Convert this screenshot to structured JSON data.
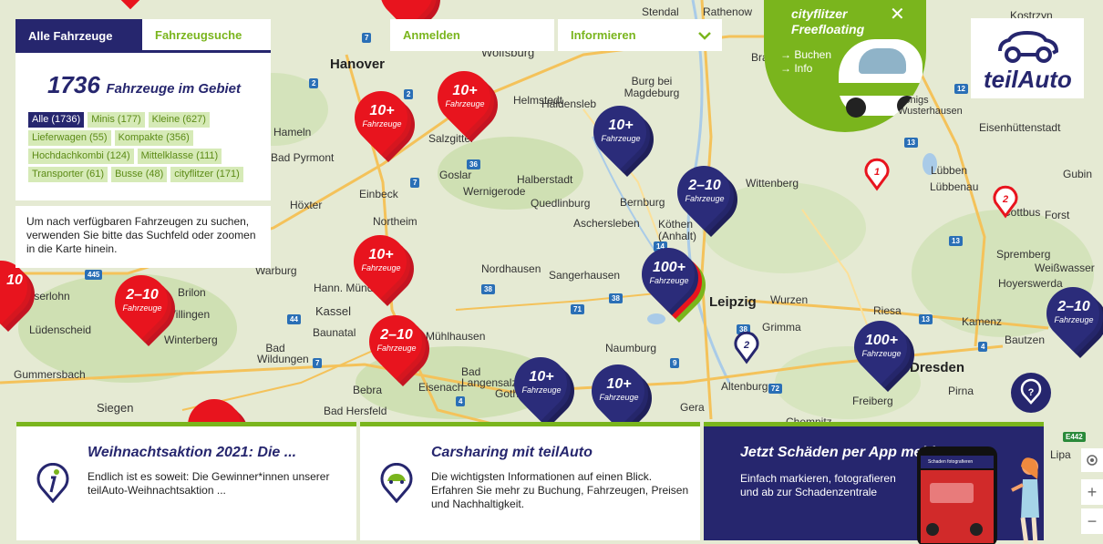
{
  "tabs": {
    "all": "Alle Fahrzeuge",
    "search": "Fahrzeugsuche"
  },
  "fleet": {
    "count": "1736",
    "count_label": "Fahrzeuge im Gebiet",
    "chips": [
      {
        "label": "Alle (1736)",
        "active": true
      },
      {
        "label": "Minis (177)",
        "active": false
      },
      {
        "label": "Kleine (627)",
        "active": false
      },
      {
        "label": "Lieferwagen (55)",
        "active": false
      },
      {
        "label": "Kompakte (356)",
        "active": false
      },
      {
        "label": "Hochdachkombi (124)",
        "active": false
      },
      {
        "label": "Mittelklasse (111)",
        "active": false
      },
      {
        "label": "Transporter (61)",
        "active": false
      },
      {
        "label": "Busse (48)",
        "active": false
      },
      {
        "label": "cityflitzer (171)",
        "active": false
      }
    ]
  },
  "hint": "Um nach verfügbaren Fahrzeugen zu suchen, verwenden Sie bitte das Suchfeld oder zoomen in die Karte hinein.",
  "header": {
    "login": "Anmelden",
    "info": "Informieren"
  },
  "cityflitzer": {
    "title_line1": "cityflitzer",
    "title_line2": "Freefloating",
    "link_book": "→ Buchen",
    "link_info": "→ Info",
    "car_brand": "cityflitzer"
  },
  "logo": {
    "text": "teilAuto"
  },
  "cards": [
    {
      "title": "Weihnachtsaktion 2021: Die ...",
      "body": "Endlich ist es soweit: Die Gewinner*innen unserer teilAuto-Weihnachtsaktion ..."
    },
    {
      "title": "Carsharing mit teilAuto",
      "body": "Die wichtigsten Informationen auf einen Blick. Erfahren Sie mehr zu Buchung, Fahrzeugen, Preisen und Nachhaltigkeit."
    },
    {
      "title": "Jetzt Schäden per App melden",
      "body": "Einfach markieren, fotografieren und ab zur Schadenzentrale",
      "phone_header": "Schaden fotografieren"
    }
  ],
  "pin_sub": "Fahrzeuge",
  "pins": [
    {
      "label": "10+",
      "color": "red"
    },
    {
      "label": "10+",
      "color": "red"
    },
    {
      "label": "10+",
      "color": "blue"
    },
    {
      "label": "2–10",
      "color": "blue"
    },
    {
      "label": "10+",
      "color": "red"
    },
    {
      "label": "100+",
      "color": "blue"
    },
    {
      "label": "2–10",
      "color": "red"
    },
    {
      "label": "2–10",
      "color": "red"
    },
    {
      "label": "10+",
      "color": "blue"
    },
    {
      "label": "10+",
      "color": "blue"
    },
    {
      "label": "100+",
      "color": "blue"
    },
    {
      "label": "2–10",
      "color": "blue"
    },
    {
      "label": "10",
      "color": "red"
    }
  ],
  "mini_pins": [
    "1",
    "2",
    "2"
  ],
  "cities": [
    "Stendal",
    "Rathenow",
    "Kostrzyn",
    "Wolfsburg",
    "Hanover",
    "Brandenb",
    "Burg bei Magdeburg",
    "Helmstedt",
    "Haldensleb",
    "Königs Wusterhausen",
    "Eisenhüttenstadt",
    "Hameln",
    "Salzgitter",
    "Bad Pyrmont",
    "Goslar",
    "Halberstadt",
    "Wernigerode",
    "Quedlinburg",
    "Bernburg",
    "Wittenberg",
    "Lübben",
    "Lübbenau",
    "Gubin",
    "Einbeck",
    "Höxter",
    "Aschersleben",
    "Köthen (Anhalt)",
    "Cottbus",
    "Forst",
    "Northeim",
    "Spremberg",
    "Weißwasser",
    "Nordhausen",
    "Sangerhausen",
    "Hoyerswerda",
    "Warburg",
    "Hann. Münden",
    "Brilon",
    "Leipzig",
    "Wurzen",
    "Iserlohn",
    "Kassel",
    "Riesa",
    "Kamenz",
    "Villingen",
    "Lüdenscheid",
    "Baunatal",
    "Mühlhausen",
    "Grimma",
    "Bautzen",
    "Winterberg",
    "Bad Wildungen",
    "Naumburg",
    "Gummersbach",
    "Bad Langensalza",
    "Gotha",
    "Eisenach",
    "Bebra",
    "Altenburg",
    "Freiberg",
    "Pirna",
    "Siegen",
    "Bad Hersfeld",
    "Gera",
    "Chemnitz",
    "Lipa",
    "Dresden"
  ],
  "controls": {
    "plus": "+",
    "minus": "−"
  }
}
